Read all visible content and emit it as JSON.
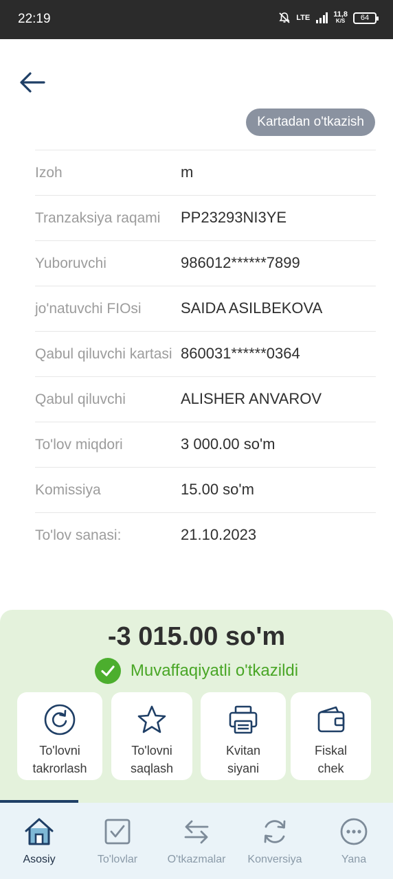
{
  "status_bar": {
    "time": "22:19",
    "network": "LTE",
    "speed": "11,8",
    "speed_unit": "K/S",
    "battery": "64"
  },
  "header": {
    "transfer_type": "Kartadan o'tkazish"
  },
  "details": [
    {
      "label": "Izoh",
      "value": "m"
    },
    {
      "label": "Tranzaksiya raqami",
      "value": "PP23293NI3YE"
    },
    {
      "label": "Yuboruvchi",
      "value": "986012******7899"
    },
    {
      "label": "jo'natuvchi FIOsi",
      "value": "SAIDA ASILBEKOVA"
    },
    {
      "label": "Qabul qiluvchi kartasi",
      "value": "860031******0364"
    },
    {
      "label": "Qabul qiluvchi",
      "value": "ALISHER ANVAROV"
    },
    {
      "label": "To'lov miqdori",
      "value": "3 000.00 so'm"
    },
    {
      "label": "Komissiya",
      "value": "15.00 so'm"
    },
    {
      "label": "To'lov sanasi:",
      "value": "21.10.2023"
    }
  ],
  "summary": {
    "amount": "-3 015.00 so'm",
    "status": "Muvaffaqiyatli o'tkazildi",
    "status_color": "#49a626"
  },
  "actions": [
    {
      "label": "To'lovni\ntakrorlash",
      "icon": "repeat-icon"
    },
    {
      "label": "To'lovni\nsaqlash",
      "icon": "star-icon"
    },
    {
      "label": "Kvitan\nsiyani",
      "icon": "printer-icon"
    },
    {
      "label": "Fiskal\nchek",
      "icon": "wallet-icon"
    }
  ],
  "nav": [
    {
      "label": "Asosiy",
      "icon": "home-icon",
      "active": true
    },
    {
      "label": "To'lovlar",
      "icon": "checkbox-icon",
      "active": false
    },
    {
      "label": "O'tkazmalar",
      "icon": "transfer-arrows-icon",
      "active": false
    },
    {
      "label": "Konversiya",
      "icon": "refresh-icon",
      "active": false
    },
    {
      "label": "Yana",
      "icon": "more-icon",
      "active": false
    }
  ],
  "colors": {
    "accent": "#1f3f66",
    "success": "#4cae2e",
    "panel_bg": "#e4f2dc",
    "chip_bg": "#8a92a0"
  }
}
